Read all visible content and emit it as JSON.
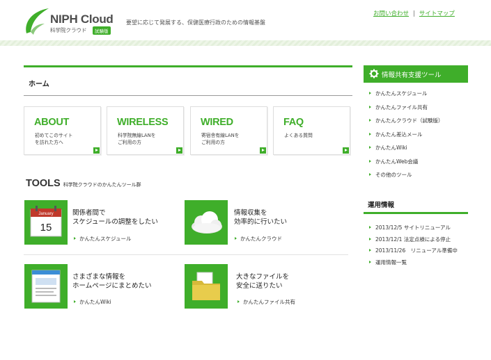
{
  "header": {
    "logo_title": "NIPH Cloud",
    "logo_sub": "科学院クラウド",
    "logo_badge": "試験版",
    "tagline": "要望に応じて発展する、保健医療行政のための情報基盤",
    "links": [
      "お問い合わせ",
      "サイトマップ"
    ],
    "link_separator": "|"
  },
  "main": {
    "home_title": "ホーム",
    "nav_boxes": [
      {
        "title": "ABOUT",
        "desc_line1": "初めてこのサイト",
        "desc_line2": "を訪れた方へ"
      },
      {
        "title": "WIRELESS",
        "desc_line1": "科学院無線LANを",
        "desc_line2": "ご利用の方"
      },
      {
        "title": "WIRED",
        "desc_line1": "寄宿舎有線LANを",
        "desc_line2": "ご利用の方"
      },
      {
        "title": "FAQ",
        "desc_line1": "よくある質問",
        "desc_line2": ""
      }
    ],
    "tools_title": "TOOLS",
    "tools_subtitle": "科学院クラウドのかんたんツール群",
    "tools": [
      {
        "line1": "関係者間で",
        "line2": "スケジュールの調整をしたい",
        "link": "かんたんスケジュール",
        "icon": "calendar-icon",
        "calendar_month": "January",
        "calendar_day": "15"
      },
      {
        "line1": "情報収集を",
        "line2": "効率的に行いたい",
        "link": "かんたんクラウド",
        "icon": "cloud-icon"
      },
      {
        "line1": "さまざまな情報を",
        "line2": "ホームページにまとめたい",
        "link": "かんたんWiki",
        "icon": "webpage-icon"
      },
      {
        "line1": "大きなファイルを",
        "line2": "安全に送りたい",
        "link": "かんたんファイル共有",
        "icon": "folder-icon"
      }
    ]
  },
  "sidebar": {
    "tools_header": "情報共有支援ツール",
    "tools_items": [
      "かんたんスケジュール",
      "かんたんファイル共有",
      "かんたんクラウド（試験版）",
      "かんたん差込メール",
      "かんたんWiki",
      "かんたんWeb会議",
      "その他のツール"
    ],
    "ops_title": "運用情報",
    "ops_items": [
      "2013/12/5 サイトリニューアル",
      "2013/12/1 法定点検による停止",
      "2013/11/26　リニューアル準備中",
      "運用情報一覧"
    ]
  },
  "colors": {
    "accent": "#3fae2a",
    "text": "#333333",
    "border": "#dddddd"
  }
}
